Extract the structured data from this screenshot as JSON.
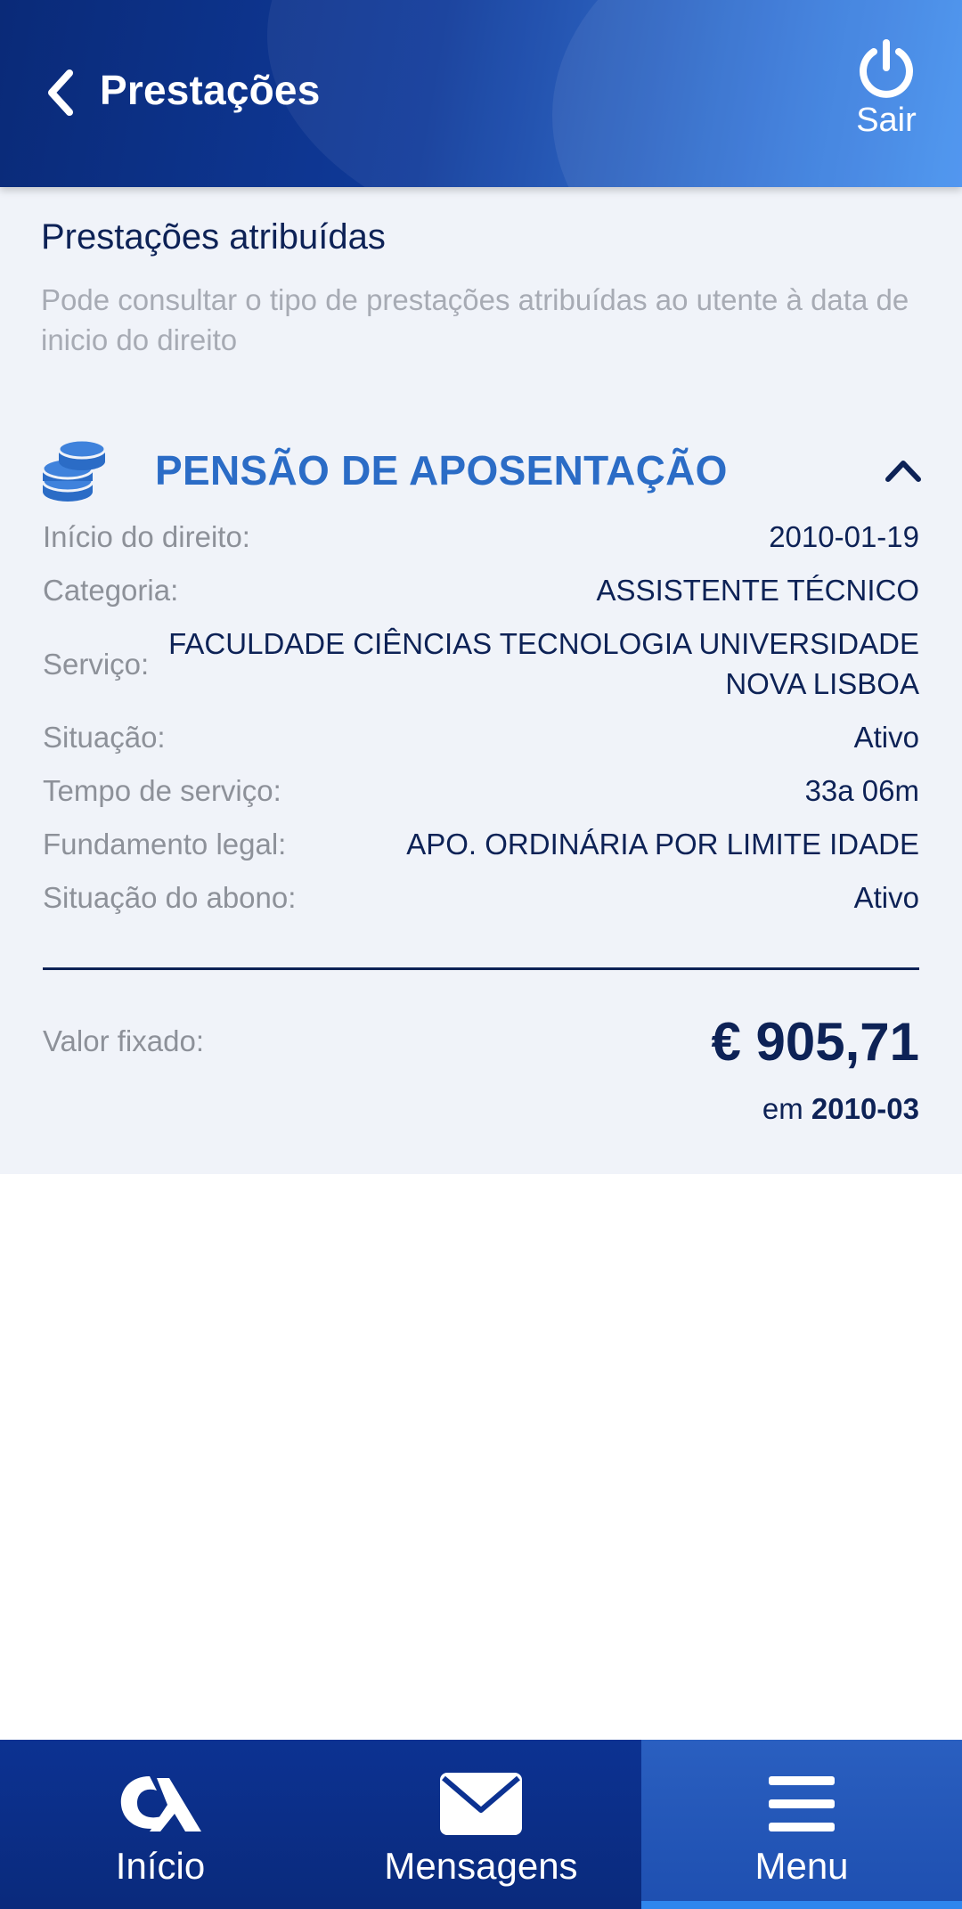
{
  "header": {
    "title": "Prestações",
    "logout_label": "Sair"
  },
  "intro": {
    "title": "Prestações atribuídas",
    "description": "Pode consultar o tipo de prestações atribuídas ao utente à data de inicio do direito"
  },
  "benefit": {
    "name": "PENSÃO DE APOSENTAÇÃO",
    "icon": "coins-icon",
    "expanded": true,
    "details": [
      {
        "label": "Início do direito:",
        "value": "2010-01-19"
      },
      {
        "label": "Categoria:",
        "value": "ASSISTENTE TÉCNICO"
      },
      {
        "label": "Serviço:",
        "value": "FACULDADE CIÊNCIAS TECNOLOGIA UNIVERSIDADE NOVA LISBOA"
      },
      {
        "label": "Situação:",
        "value": "Ativo"
      },
      {
        "label": "Tempo de serviço:",
        "value": "33a 06m"
      },
      {
        "label": "Fundamento legal:",
        "value": "APO. ORDINÁRIA POR LIMITE IDADE"
      },
      {
        "label": "Situação do abono:",
        "value": "Ativo"
      }
    ],
    "valor_label": "Valor fixado:",
    "valor_amount": "€ 905,71",
    "valor_prefix": "em",
    "valor_date": "2010-03"
  },
  "bottom_nav": {
    "items": [
      {
        "label": "Início",
        "icon": "logo-icon",
        "active": false
      },
      {
        "label": "Mensagens",
        "icon": "envelope-icon",
        "active": false
      },
      {
        "label": "Menu",
        "icon": "hamburger-menu-icon",
        "active": true
      }
    ]
  },
  "colors": {
    "header_dark": "#0a2a78",
    "header_light": "#3a8aee",
    "accent": "#2b6cc6",
    "text_dark": "#0d2256",
    "text_muted": "#8d9199",
    "content_bg": "#f0f3f9"
  }
}
